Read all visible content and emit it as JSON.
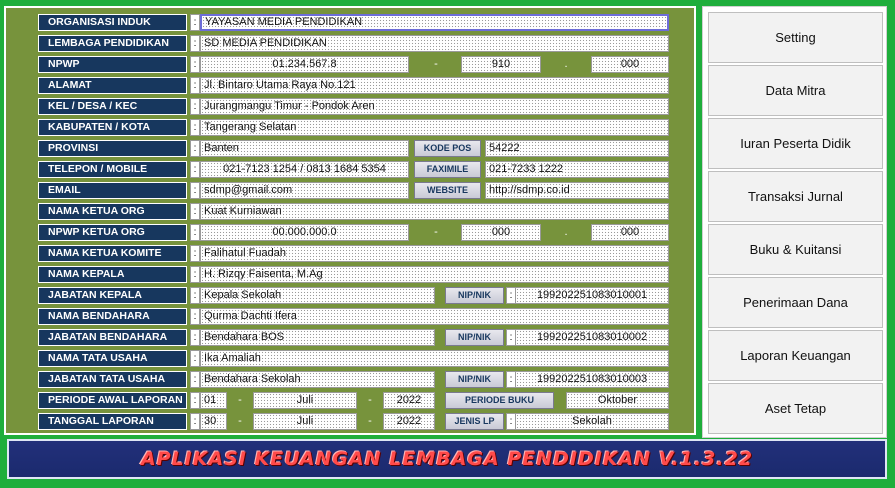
{
  "form": {
    "organisasi_induk": {
      "label": "ORGANISASI INDUK",
      "value": "YAYASAN MEDIA PENDIDIKAN"
    },
    "lembaga_pendidikan": {
      "label": "LEMBAGA PENDIDIKAN",
      "value": "SD MEDIA PENDIDIKAN"
    },
    "npwp": {
      "label": "NPWP",
      "part1": "01.234.567.8",
      "part2": "910",
      "part3": "000"
    },
    "alamat": {
      "label": "ALAMAT",
      "value": "Jl. Bintaro Utama Raya No.121"
    },
    "kel_desa_kec": {
      "label": "KEL / DESA / KEC",
      "value": "Jurangmangu Timur - Pondok Aren"
    },
    "kabupaten_kota": {
      "label": "KABUPATEN / KOTA",
      "value": "Tangerang Selatan"
    },
    "provinsi": {
      "label": "PROVINSI",
      "value": "Banten",
      "kodepos_label": "KODE POS",
      "kodepos_value": "54222"
    },
    "telepon": {
      "label": "TELEPON / MOBILE",
      "value": "021-7123 1254 / 0813 1684 5354",
      "fax_label": "FAXIMILE",
      "fax_value": "021-7233 1222"
    },
    "email": {
      "label": "EMAIL",
      "value": "sdmp@gmail.com",
      "website_label": "WEBSITE",
      "website_value": "http://sdmp.co.id"
    },
    "nama_ketua_org": {
      "label": "NAMA KETUA ORG",
      "value": "Kuat Kurniawan"
    },
    "npwp_ketua_org": {
      "label": "NPWP KETUA ORG",
      "part1": "00.000.000.0",
      "part2": "000",
      "part3": "000"
    },
    "nama_ketua_komite": {
      "label": "NAMA KETUA KOMITE",
      "value": "Falihatul Fuadah"
    },
    "nama_kepala": {
      "label": "NAMA KEPALA",
      "value": "H. Rizqy Faisenta, M.Ag"
    },
    "jabatan_kepala": {
      "label": "JABATAN KEPALA",
      "value": "Kepala Sekolah",
      "nip_label": "NIP/NIK",
      "nip_value": "199202251083010001"
    },
    "nama_bendahara": {
      "label": "NAMA BENDAHARA",
      "value": "Qurma Dachti Ifera"
    },
    "jabatan_bendahara": {
      "label": "JABATAN BENDAHARA",
      "value": "Bendahara BOS",
      "nip_label": "NIP/NIK",
      "nip_value": "199202251083010002"
    },
    "nama_tata_usaha": {
      "label": "NAMA TATA USAHA",
      "value": "Ika Amaliah"
    },
    "jabatan_tata_usaha": {
      "label": "JABATAN TATA USAHA",
      "value": "Bendahara Sekolah",
      "nip_label": "NIP/NIK",
      "nip_value": "199202251083010003"
    },
    "periode_awal": {
      "label": "PERIODE AWAL LAPORAN",
      "day": "01",
      "month": "Juli",
      "year": "2022",
      "periode_buku_label": "PERIODE BUKU",
      "periode_buku_value": "Oktober"
    },
    "tanggal_laporan": {
      "label": "TANGGAL LAPORAN",
      "day": "30",
      "month": "Juli",
      "year": "2022",
      "jenis_lp_label": "JENIS LP",
      "jenis_lp_value": "Sekolah"
    }
  },
  "separators": {
    "colon": ":",
    "dash": "-",
    "dot": "."
  },
  "menu": [
    "Setting",
    "Data Mitra",
    "Iuran Peserta Didik",
    "Transaksi Jurnal",
    "Buku & Kuitansi",
    "Penerimaan Dana",
    "Laporan Keuangan",
    "Aset Tetap"
  ],
  "banner": {
    "title": "APLIKASI KEUANGAN LEMBAGA PENDIDIKAN V.1.3.22"
  },
  "colors": {
    "page_bg": "#1fae3c",
    "panel_bg": "#77933c",
    "label_bg": "#17375e",
    "banner_bg": "#1b2a6e",
    "banner_text": "#ff4a4a"
  }
}
